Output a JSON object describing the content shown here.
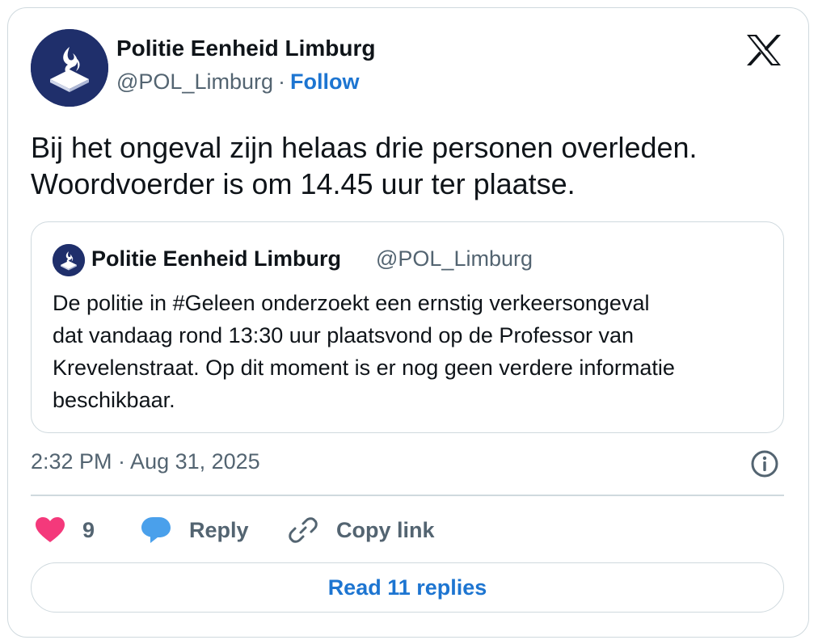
{
  "author": {
    "name": "Politie Eenheid Limburg",
    "handle": "@POL_Limburg",
    "separator": "·",
    "follow_label": "Follow",
    "avatar_icon": "police-logo-icon",
    "avatar_color": "#1f2f6b"
  },
  "tweet": {
    "lines": [
      "Bij het ongeval zijn helaas drie personen overleden.",
      "Woordvoerder is om 14.45 uur ter plaatse."
    ]
  },
  "quoted_tweet": {
    "name": "Politie Eenheid Limburg",
    "handle": "@POL_Limburg",
    "lines": [
      "De politie in #Geleen onderzoekt een ernstig verkeersongeval",
      "dat vandaag rond 13:30 uur plaatsvond op de Professor van",
      "Krevelenstraat. Op dit moment is er nog geen verdere informatie",
      "beschikbaar."
    ]
  },
  "timestamp": "2:32 PM · Aug 31, 2025",
  "actions": {
    "like_count": "9",
    "reply_label": "Reply",
    "copy_link_label": "Copy link"
  },
  "read_replies_label": "Read 11 replies",
  "colors": {
    "accent": "#1d75d1",
    "like": "#f4397b",
    "reply_bubble": "#4aa0eb",
    "muted_text": "#536471",
    "border": "#cfd9de"
  }
}
